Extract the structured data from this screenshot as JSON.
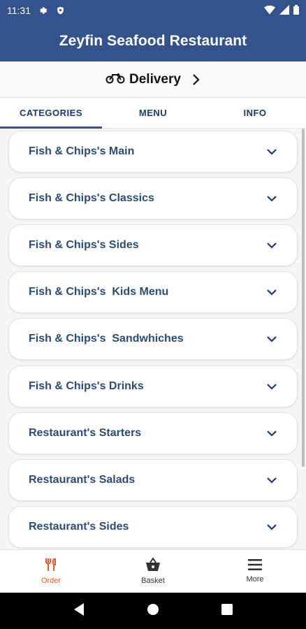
{
  "status_bar": {
    "time": "11:31"
  },
  "app_bar": {
    "title": "Zeyfin Seafood Restaurant"
  },
  "delivery": {
    "label": "Delivery"
  },
  "tabs": [
    {
      "label": "CATEGORIES",
      "active": true
    },
    {
      "label": "MENU",
      "active": false
    },
    {
      "label": "INFO",
      "active": false
    }
  ],
  "categories": [
    "Fish & Chips's Main",
    "Fish & Chips's Classics",
    "Fish & Chips's Sides",
    "Fish & Chips's  Kids Menu",
    "Fish & Chips's  Sandwhiches",
    "Fish & Chips's Drinks",
    "Restaurant's Starters",
    "Restaurant's Salads",
    "Restaurant's Sides"
  ],
  "bottom_nav": [
    {
      "label": "Order",
      "icon": "fork-knife-icon",
      "active": true
    },
    {
      "label": "Basket",
      "icon": "basket-icon",
      "active": false
    },
    {
      "label": "More",
      "icon": "menu-icon",
      "active": false
    }
  ],
  "colors": {
    "primary": "#34538a",
    "accent": "#e55a2b",
    "category_text": "#2d4b73"
  }
}
